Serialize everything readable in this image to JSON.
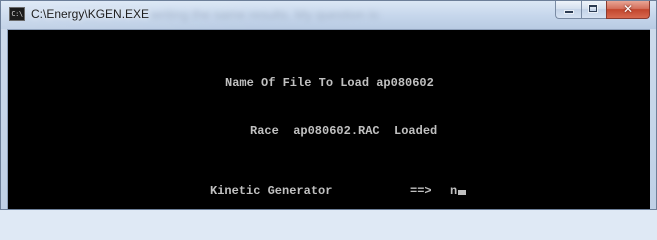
{
  "window": {
    "title": "C:\\Energy\\KGEN.EXE",
    "icon": "console-app-icon",
    "icon_label": "C:\\",
    "background_text": "writing the same results. My question is:"
  },
  "console": {
    "prompt_file": "Name Of File To Load ap080602",
    "race_line": "Race  ap080602.RAC  Loaded",
    "generator_label": "Kinetic Generator",
    "arrow": "==>",
    "input_value": "n"
  },
  "colors": {
    "console_bg": "#000000",
    "console_text": "#c0c0c0",
    "titlebar": "#c7d7ec",
    "close_button": "#c2452d"
  }
}
